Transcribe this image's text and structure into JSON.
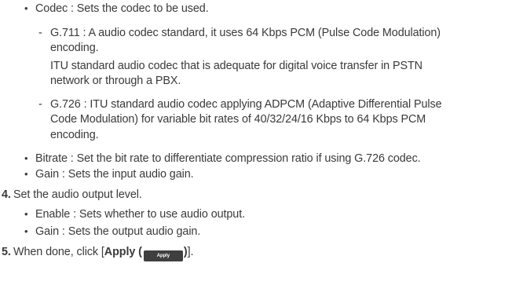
{
  "codec_item": {
    "bullet": "•",
    "text": "Codec : Sets the codec to be used."
  },
  "g711": {
    "dash": "-",
    "line1": "G.711 : A audio codec standard, it uses 64 Kbps PCM (Pulse Code Modulation)",
    "line2": "encoding.",
    "line3": "ITU standard audio codec that is adequate for digital voice transfer in PSTN",
    "line4": "network or through a PBX."
  },
  "g726": {
    "dash": "-",
    "line1": "G.726 : ITU standard audio codec applying ADPCM (Adaptive Differential Pulse",
    "line2": "Code Modulation) for variable bit rates of 40/32/24/16 Kbps to 64 Kbps PCM",
    "line3": "encoding."
  },
  "bitrate_item": {
    "bullet": "•",
    "text": "Bitrate : Set the bit rate to differentiate compression ratio if using G.726 codec."
  },
  "input_gain_item": {
    "bullet": "•",
    "text": "Gain : Sets the input audio gain."
  },
  "step4": {
    "number": "4.",
    "text": "Set the audio output level."
  },
  "enable_item": {
    "bullet": "•",
    "text": "Enable : Sets whether to use audio output."
  },
  "output_gain_item": {
    "bullet": "•",
    "text": "Gain : Sets the output audio gain."
  },
  "step5": {
    "number": "5.",
    "prefix": "When done, click [",
    "apply_label": "Apply (",
    "button_text": "Apply",
    "apply_close": ")",
    "suffix": "]."
  }
}
